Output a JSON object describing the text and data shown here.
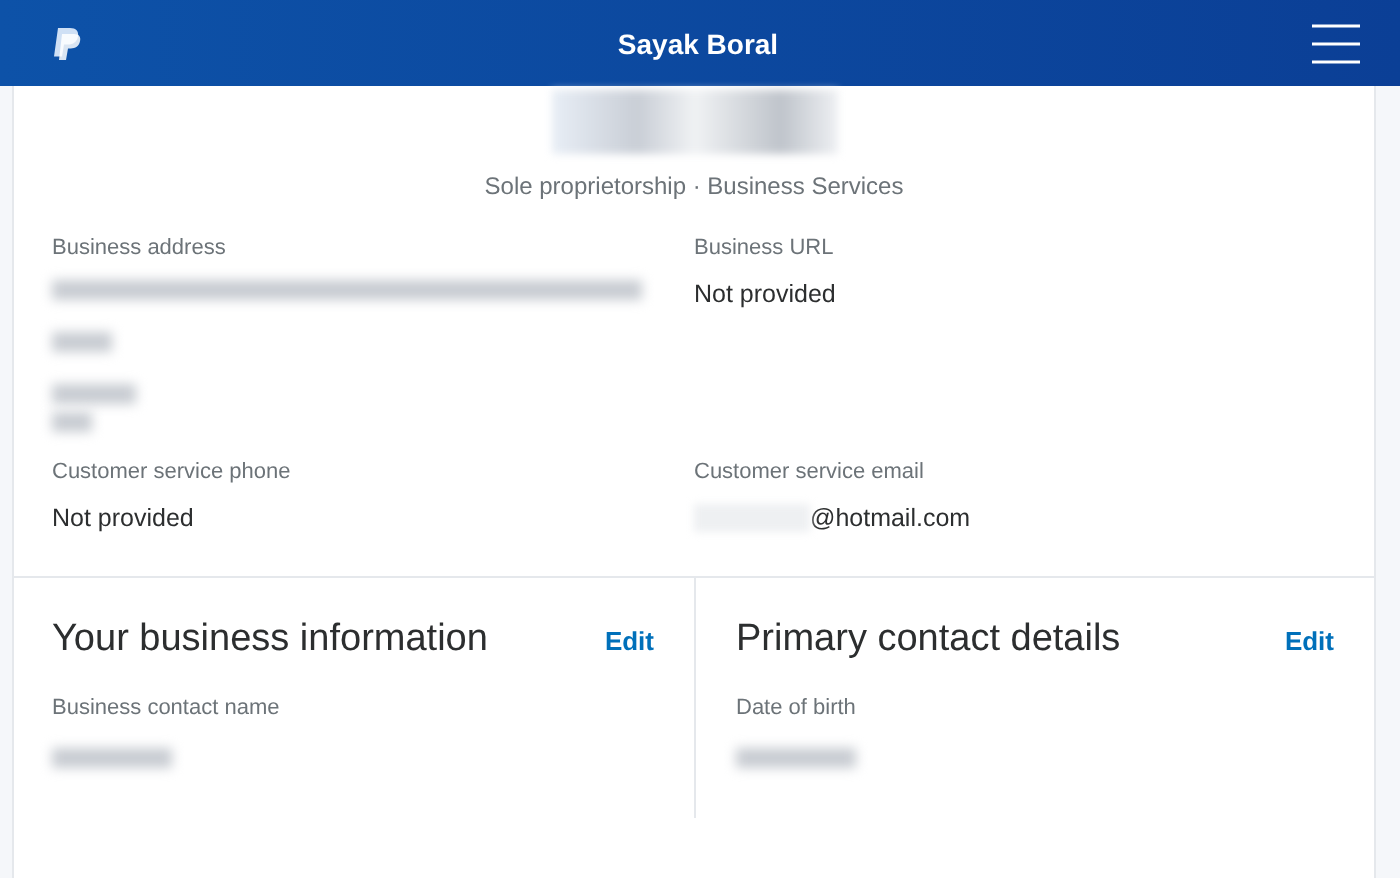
{
  "header": {
    "title": "Sayak Boral"
  },
  "profile": {
    "subtitle": "Sole proprietorship · Business Services"
  },
  "fields": [
    {
      "label": "Business address",
      "value_hidden": true
    },
    {
      "label": "Business URL",
      "value": "Not provided"
    },
    {
      "label": "Customer service phone",
      "value": "Not provided"
    },
    {
      "label": "Customer service email",
      "value": "@hotmail.com"
    }
  ],
  "sections": [
    {
      "title": "Your business information",
      "action": "Edit",
      "field_label": "Business contact name"
    },
    {
      "title": "Primary contact details",
      "action": "Edit",
      "field_label": "Date of birth"
    }
  ]
}
